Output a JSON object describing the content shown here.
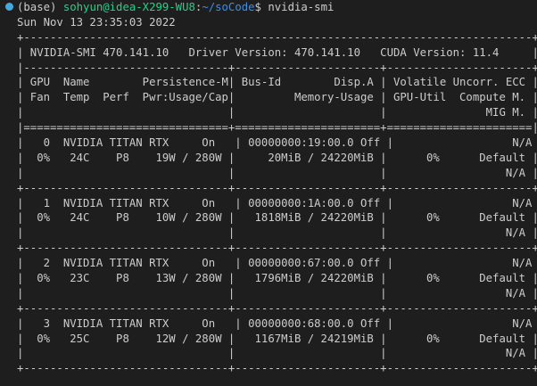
{
  "prompt": {
    "env": "(base) ",
    "user_host": "sohyun@idea-X299-WU8",
    "colon": ":",
    "path": "~/soCode",
    "symbol": "$ ",
    "command": "nvidia-smi"
  },
  "timestamp": "Sun Nov 13 23:35:03 2022",
  "output_lines": [
    "+-----------------------------------------------------------------------------+",
    "| NVIDIA-SMI 470.141.10   Driver Version: 470.141.10   CUDA Version: 11.4     |",
    "|-------------------------------+----------------------+----------------------+",
    "| GPU  Name        Persistence-M| Bus-Id        Disp.A | Volatile Uncorr. ECC |",
    "| Fan  Temp  Perf  Pwr:Usage/Cap|         Memory-Usage | GPU-Util  Compute M. |",
    "|                               |                      |               MIG M. |",
    "|===============================+======================+======================|",
    "|   0  NVIDIA TITAN RTX     On   | 00000000:19:00.0 Off |                  N/A |",
    "|  0%   24C    P8    19W / 280W |     20MiB / 24220MiB |      0%      Default |",
    "|                               |                      |                  N/A |",
    "+-------------------------------+----------------------+----------------------+",
    "|   1  NVIDIA TITAN RTX     On   | 00000000:1A:00.0 Off |                  N/A |",
    "|  0%   24C    P8    10W / 280W |   1818MiB / 24220MiB |      0%      Default |",
    "|                               |                      |                  N/A |",
    "+-------------------------------+----------------------+----------------------+",
    "|   2  NVIDIA TITAN RTX     On   | 00000000:67:00.0 Off |                  N/A |",
    "|  0%   23C    P8    13W / 280W |   1796MiB / 24220MiB |      0%      Default |",
    "|                               |                      |                  N/A |",
    "+-------------------------------+----------------------+----------------------+",
    "|   3  NVIDIA TITAN RTX     On   | 00000000:68:00.0 Off |                  N/A |",
    "|  0%   25C    P8    12W / 280W |   1167MiB / 24219MiB |      0%      Default |",
    "|                               |                      |                  N/A |",
    "+-------------------------------+----------------------+----------------------+"
  ],
  "colors": {
    "background": "#1e1e1e",
    "text": "#cccccc",
    "user_host": "#23d18b",
    "path": "#3b8eea",
    "prompt_dot": "#4fc1ff"
  }
}
